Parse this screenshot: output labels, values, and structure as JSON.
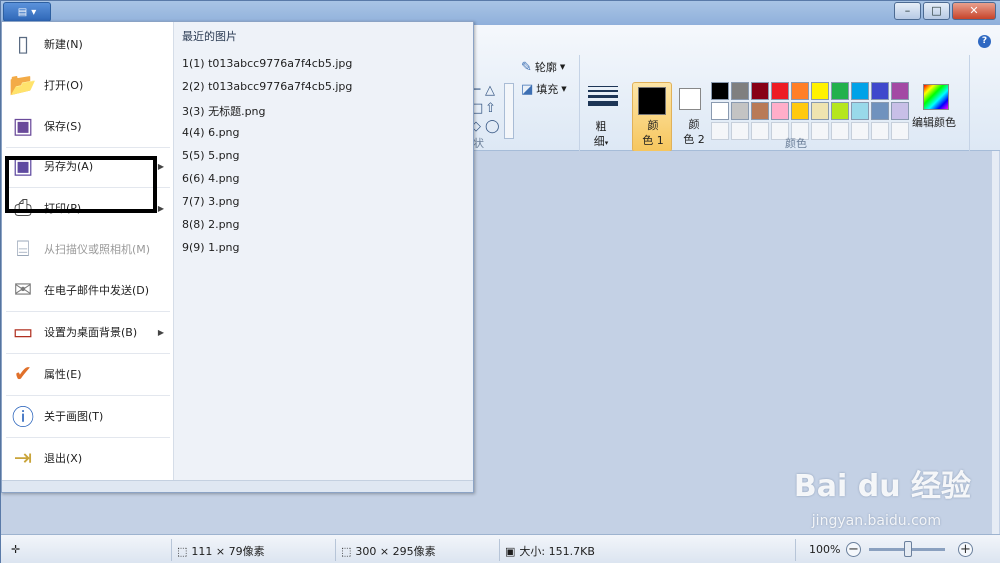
{
  "window": {
    "controls": {
      "minimize": "–",
      "maximize": "□",
      "close": "✕"
    },
    "help": "?"
  },
  "app_button": {
    "icon": "menu-icon",
    "chevron": "▾"
  },
  "app_menu": {
    "items": [
      {
        "label": "新建(N)",
        "icon": "new-file-icon"
      },
      {
        "label": "打开(O)",
        "icon": "open-folder-icon"
      },
      {
        "label": "保存(S)",
        "icon": "save-disk-icon"
      },
      {
        "label": "另存为(A)",
        "icon": "save-as-icon",
        "submenu": true
      },
      {
        "label": "打印(P)",
        "icon": "printer-icon",
        "submenu": true
      },
      {
        "label": "从扫描仪或照相机(M)",
        "icon": "scanner-icon",
        "disabled": true
      },
      {
        "label": "在电子邮件中发送(D)",
        "icon": "email-icon"
      },
      {
        "label": "设置为桌面背景(B)",
        "icon": "desktop-icon",
        "submenu": true
      },
      {
        "label": "属性(E)",
        "icon": "checkmark-icon"
      },
      {
        "label": "关于画图(T)",
        "icon": "info-icon"
      },
      {
        "label": "退出(X)",
        "icon": "exit-icon"
      }
    ],
    "recent_title": "最近的图片",
    "recent": [
      "1(1)  t013abcc9776a7f4cb5.jpg",
      "2(2)  t013abcc9776a7f4cb5.jpg",
      "3(3)  无标题.png",
      "4(4)  6.png",
      "5(5)  5.png",
      "6(6)  4.png",
      "7(7)  3.png",
      "8(8)  2.png",
      "9(9)  1.png"
    ]
  },
  "ribbon": {
    "outline_label": "轮廓",
    "fill_label": "填充",
    "shapes_group_label": "状",
    "weight_label_1": "粗",
    "weight_label_2": "细",
    "color1_label_1": "颜",
    "color1_label_2": "色 1",
    "color2_label_1": "颜",
    "color2_label_2": "色 2",
    "edit_colors_label": "编辑颜色",
    "colors_group_label": "颜色",
    "palette_row1": [
      "#000000",
      "#7f7f7f",
      "#880015",
      "#ed1c24",
      "#ff7f27",
      "#fff200",
      "#22b14c",
      "#00a2e8",
      "#3f48cc",
      "#a349a4"
    ],
    "palette_row2": [
      "#ffffff",
      "#c3c3c3",
      "#b97a57",
      "#ffaec9",
      "#ffc90e",
      "#efe4b0",
      "#b5e61d",
      "#99d9ea",
      "#7092be",
      "#c8bfe7"
    ]
  },
  "status": {
    "selection_size": "111 × 79像素",
    "image_size": "300 × 295像素",
    "file_size": "大小: 151.7KB",
    "zoom": "100%",
    "zoom_level": 1.0
  },
  "watermark": {
    "brand": "Bai du 经验",
    "url": "jingyan.baidu.com"
  }
}
